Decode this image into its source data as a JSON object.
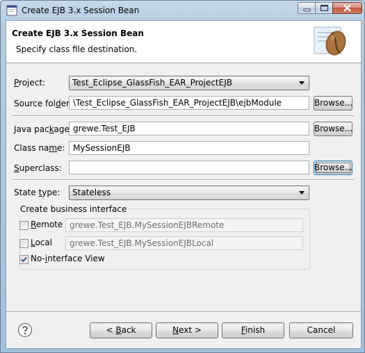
{
  "window": {
    "title": "Create EJB 3.x Session Bean"
  },
  "header": {
    "title": "Create EJB 3.x Session Bean",
    "subtitle": "Specify class file destination."
  },
  "form": {
    "project": {
      "label": "Project:",
      "value": "Test_Eclipse_GlassFish_EAR_ProjectEJB"
    },
    "source_folder": {
      "label": "Source folder:",
      "value": "\\Test_Eclipse_GlassFish_EAR_ProjectEJB\\ejbModule",
      "browse": "Browse..."
    },
    "java_package": {
      "label": "Java package:",
      "value": "grewe.Test_EJB",
      "browse": "Browse..."
    },
    "class_name": {
      "label": "Class name:",
      "value": "MySessionEJB"
    },
    "superclass": {
      "label": "Superclass:",
      "value": "",
      "browse": "Browse..."
    },
    "state_type": {
      "label": "State type:",
      "value": "Stateless"
    }
  },
  "business_interface": {
    "legend": "Create business interface",
    "remote": {
      "label": "Remote",
      "checked": false,
      "value": "grewe.Test_EJB.MySessionEJBRemote"
    },
    "local": {
      "label": "Local",
      "checked": false,
      "value": "grewe.Test_EJB.MySessionEJBLocal"
    },
    "no_interface": {
      "label": "No-interface View",
      "checked": true
    }
  },
  "buttons": {
    "back": "< Back",
    "next": "Next >",
    "finish": "Finish",
    "cancel": "Cancel"
  },
  "icons": {
    "app": "eclipse-app-icon",
    "help": "help-icon",
    "banner": "coffee-bean-icon"
  }
}
